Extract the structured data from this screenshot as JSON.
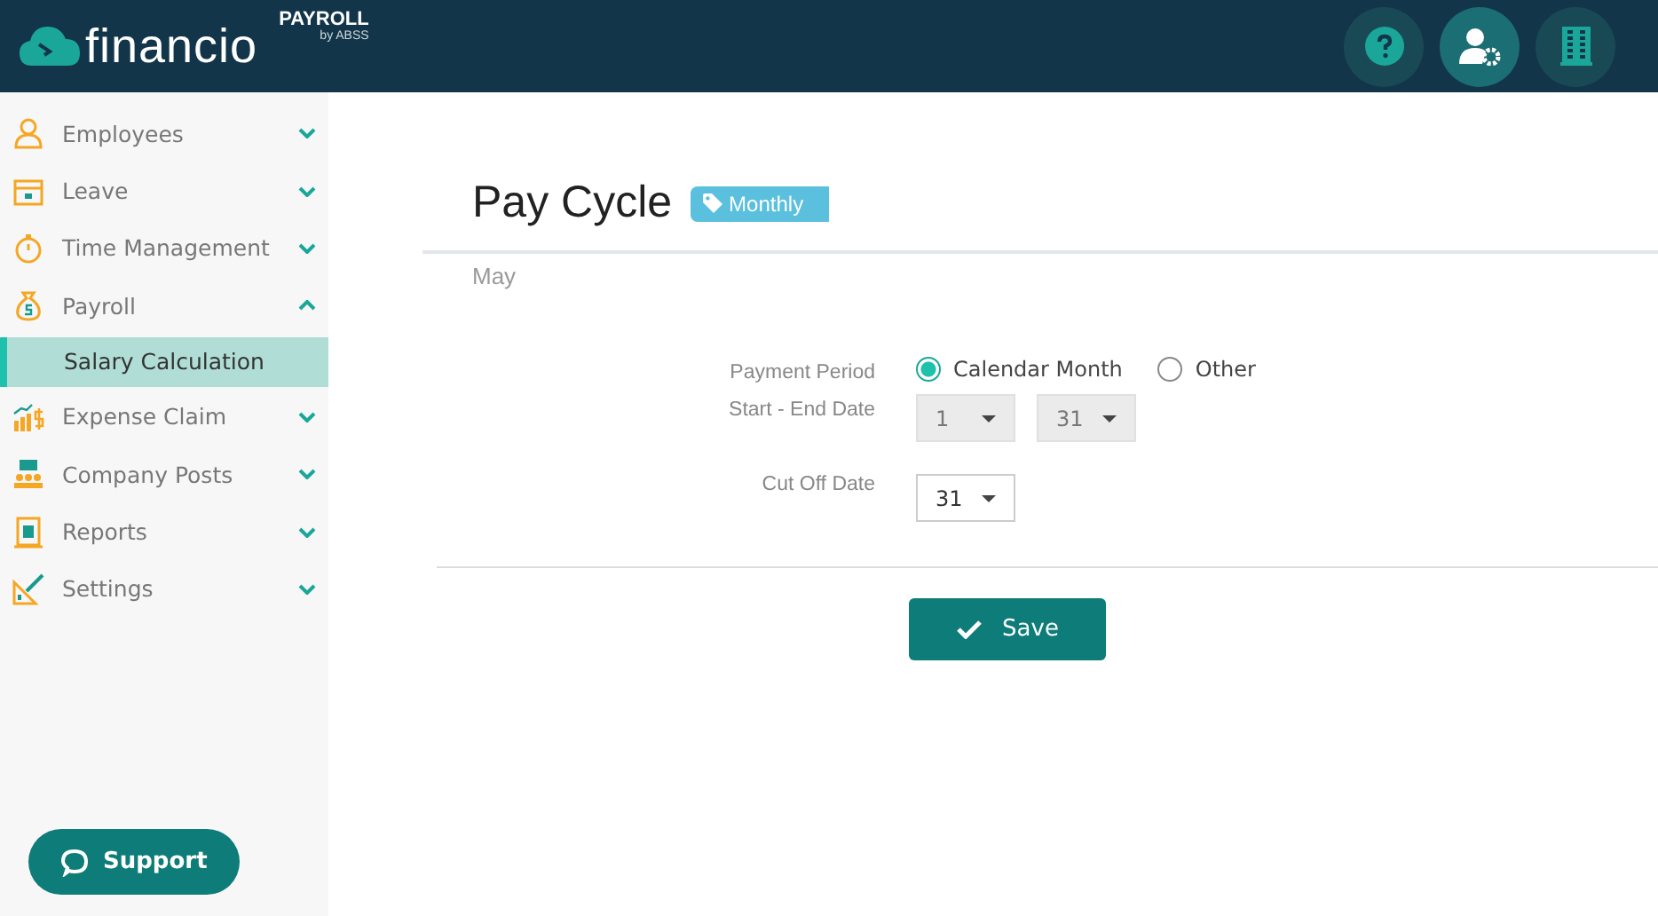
{
  "brand": {
    "name": "financio",
    "product": "PAYROLL",
    "by": "by ABSS"
  },
  "header_buttons": [
    {
      "selected": false
    },
    {
      "selected": true
    },
    {
      "selected": false
    }
  ],
  "sidebar": {
    "items": [
      {
        "label": "Employees",
        "expanded": false
      },
      {
        "label": "Leave",
        "expanded": false
      },
      {
        "label": "Time Management",
        "expanded": false
      },
      {
        "label": "Payroll",
        "expanded": true,
        "children": [
          {
            "label": "Salary Calculation",
            "selected": true
          }
        ]
      },
      {
        "label": "Expense Claim",
        "expanded": false
      },
      {
        "label": "Company Posts",
        "expanded": false
      },
      {
        "label": "Reports",
        "expanded": false
      },
      {
        "label": "Settings",
        "expanded": false
      }
    ],
    "support": "Support"
  },
  "page": {
    "title": "Pay Cycle",
    "badge": "Monthly",
    "subtitle": "May"
  },
  "form": {
    "payment_period": {
      "label": "Payment Period",
      "options": [
        {
          "label": "Calendar Month",
          "selected": true
        },
        {
          "label": "Other",
          "selected": false
        }
      ]
    },
    "start_end": {
      "label": "Start - End Date",
      "selects": [
        {
          "value": "1",
          "disabled": true
        },
        {
          "value": "31",
          "disabled": true
        }
      ]
    },
    "cut_off": {
      "label": "Cut Off Date",
      "selects": [
        {
          "value": "31",
          "disabled": false
        }
      ]
    }
  },
  "save": "Save"
}
